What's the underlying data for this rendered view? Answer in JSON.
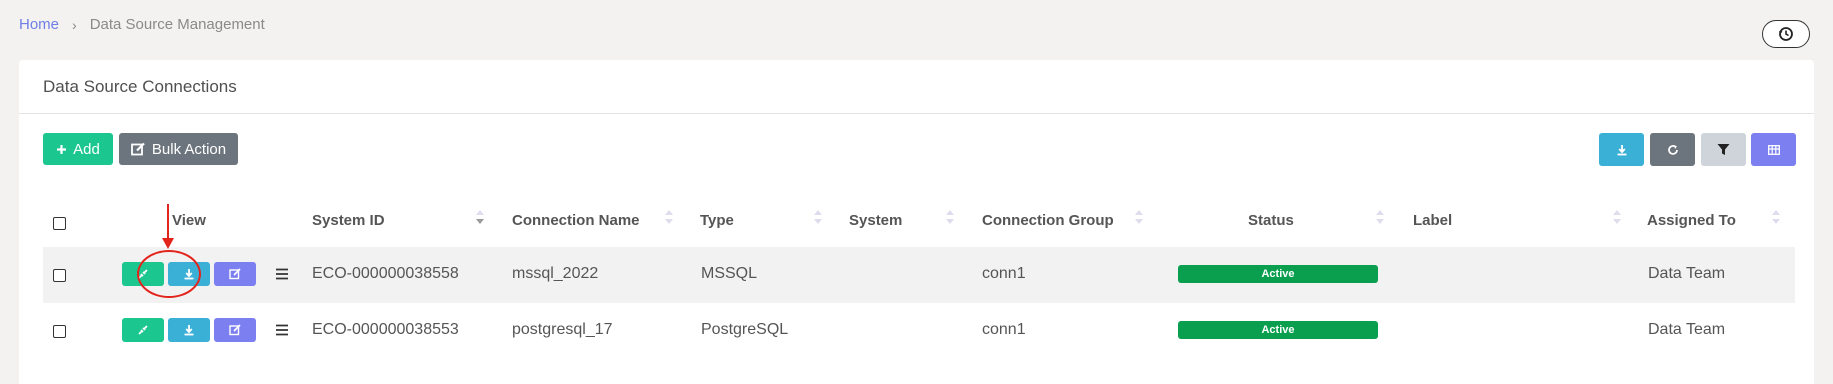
{
  "breadcrumb": {
    "home": "Home",
    "separator": "›",
    "current": "Data Source Management"
  },
  "card": {
    "title": "Data Source Connections"
  },
  "toolbar": {
    "add_label": "Add",
    "bulk_label": "Bulk Action"
  },
  "table": {
    "headers": {
      "view": "View",
      "system_id": "System ID",
      "connection_name": "Connection Name",
      "type": "Type",
      "system": "System",
      "connection_group": "Connection Group",
      "status": "Status",
      "label": "Label",
      "assigned_to": "Assigned To"
    },
    "rows": [
      {
        "system_id": "ECO-000000038558",
        "connection_name": "mssql_2022",
        "type": "MSSQL",
        "system": "",
        "connection_group": "conn1",
        "status": "Active",
        "label": "",
        "assigned_to": "Data Team"
      },
      {
        "system_id": "ECO-000000038553",
        "connection_name": "postgresql_17",
        "type": "PostgreSQL",
        "system": "",
        "connection_group": "conn1",
        "status": "Active",
        "label": "",
        "assigned_to": "Data Team"
      }
    ]
  },
  "colors": {
    "accent": "#6f7ee6",
    "success": "#1bc78f",
    "info": "#3bb0d6",
    "secondary": "#6c757d",
    "status_active": "#0a9f4f",
    "annotation": "#e3241c"
  },
  "icons": {
    "history": "history-icon",
    "plus": "plus-icon",
    "edit": "edit-icon",
    "download": "download-icon",
    "refresh": "refresh-icon",
    "filter": "filter-icon",
    "columns": "columns-icon",
    "connect": "connect-icon",
    "menu": "menu-icon"
  }
}
